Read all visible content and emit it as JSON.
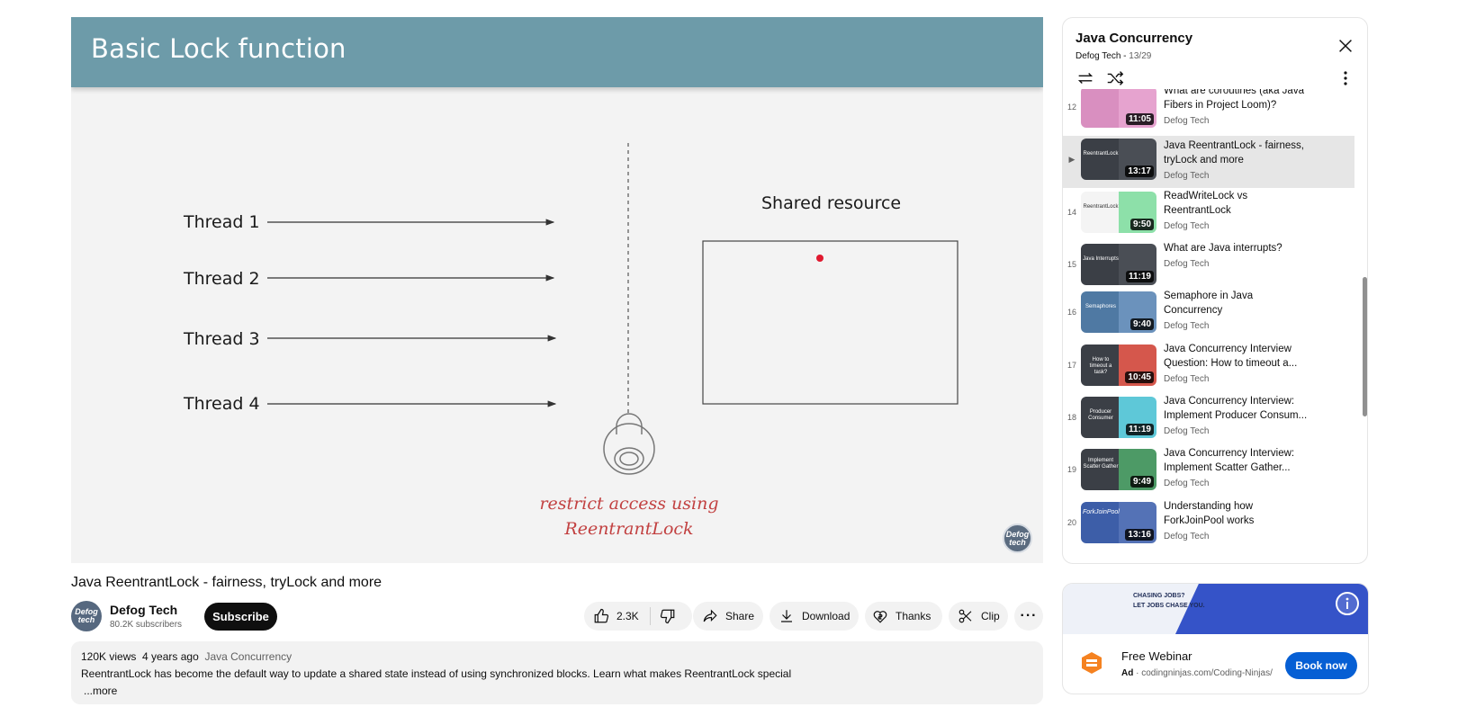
{
  "video": {
    "slide_title": "Basic Lock function",
    "threads": [
      "Thread 1",
      "Thread 2",
      "Thread 3",
      "Thread 4"
    ],
    "shared_resource": "Shared resource",
    "caption_line1": "restrict access using",
    "caption_line2": "ReentrantLock",
    "logo_text": "Defog tech"
  },
  "meta": {
    "title": "Java ReentrantLock - fairness, tryLock and more",
    "channel_name": "Defog Tech",
    "subscribers": "80.2K subscribers",
    "avatar_text": "Defog tech",
    "subscribe_label": "Subscribe"
  },
  "actions": {
    "likes": "2.3K",
    "share": "Share",
    "download": "Download",
    "thanks": "Thanks",
    "clip": "Clip"
  },
  "description": {
    "views": "120K views",
    "age": "4 years ago",
    "playlist": "Java Concurrency",
    "text": "ReentrantLock has become the default way to update a shared state instead of using synchronized blocks. Learn what makes ReentrantLock special",
    "more": "...more"
  },
  "playlist": {
    "title": "Java Concurrency",
    "channel": "Defog Tech",
    "position": "13/29",
    "items": [
      {
        "index": "12",
        "title": "What are coroutines (aka Java Fibers in Project Loom)?",
        "channel": "Defog Tech",
        "duration": "11:05",
        "thumb_text": "",
        "color_left": "#d98fc0",
        "color_right": "#e6a3cf"
      },
      {
        "index": "▶",
        "title": "Java ReentrantLock - fairness, tryLock and more",
        "channel": "Defog Tech",
        "duration": "13:17",
        "thumb_text": "ReentrantLock",
        "color_left": "#3b3f46",
        "color_right": "#4a4e55"
      },
      {
        "index": "14",
        "title": "ReadWriteLock vs ReentrantLock",
        "channel": "Defog Tech",
        "duration": "9:50",
        "thumb_text": "ReentrantLock",
        "color_left": "#f4f4f4",
        "color_right": "#8de0a9"
      },
      {
        "index": "15",
        "title": "What are Java interrupts?",
        "channel": "Defog Tech",
        "duration": "11:19",
        "thumb_text": "Java Interrupts",
        "color_left": "#3b3f46",
        "color_right": "#4a4e55"
      },
      {
        "index": "16",
        "title": "Semaphore in Java Concurrency",
        "channel": "Defog Tech",
        "duration": "9:40",
        "thumb_text": "Semaphores",
        "color_left": "#4f79a3",
        "color_right": "#6b92bc"
      },
      {
        "index": "17",
        "title": "Java Concurrency Interview Question: How to timeout a...",
        "channel": "Defog Tech",
        "duration": "10:45",
        "thumb_text": "How to timeout a task?",
        "color_left": "#3b3f46",
        "color_right": "#d5574c"
      },
      {
        "index": "18",
        "title": "Java Concurrency Interview: Implement Producer Consum...",
        "channel": "Defog Tech",
        "duration": "11:19",
        "thumb_text": "Producer Consumer",
        "color_left": "#3b3f46",
        "color_right": "#5ec8d8"
      },
      {
        "index": "19",
        "title": "Java Concurrency Interview: Implement Scatter Gather...",
        "channel": "Defog Tech",
        "duration": "9:49",
        "thumb_text": "Implement Scatter Gather",
        "color_left": "#3b3f46",
        "color_right": "#4d9a66"
      },
      {
        "index": "20",
        "title": "Understanding how ForkJoinPool works",
        "channel": "Defog Tech",
        "duration": "13:16",
        "thumb_text": "ForkJoinPool",
        "color_left": "#3d5ea8",
        "color_right": "#5472b6"
      }
    ]
  },
  "ad": {
    "banner_text_1": "CHASING JOBS?",
    "banner_text_2": "LET JOBS CHASE YOU.",
    "title": "Free Webinar",
    "label": "Ad",
    "url": "codingninjas.com/Coding-Ninjas/",
    "button": "Book now"
  }
}
